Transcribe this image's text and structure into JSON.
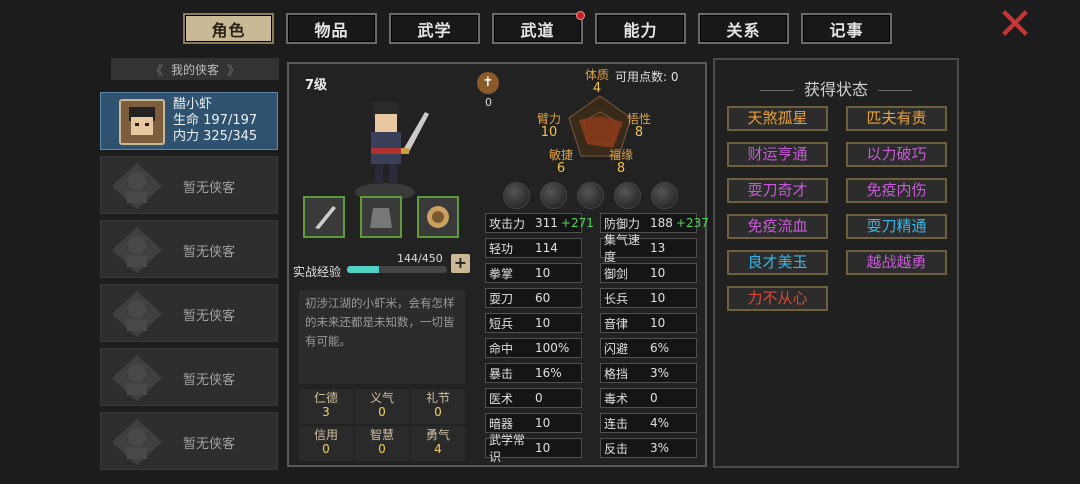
{
  "tabs": [
    {
      "label": "角色",
      "active": true
    },
    {
      "label": "物品"
    },
    {
      "label": "武学"
    },
    {
      "label": "武道",
      "badge": true
    },
    {
      "label": "能力"
    },
    {
      "label": "关系"
    },
    {
      "label": "记事"
    }
  ],
  "close": "✕",
  "sidebar": {
    "title": "我的侠客",
    "hero": {
      "name": "醋小虾",
      "hp": "生命 197/197",
      "mp": "内力 325/345"
    },
    "empty": "暂无侠客"
  },
  "profile": {
    "level": "7级",
    "exp_label": "实战经验",
    "exp": "144/450",
    "exp_ratio": 0.32,
    "desc": "初涉江湖的小虾米，会有怎样的未来还都是未知数，一切皆有可能。"
  },
  "virtues": [
    {
      "k": "仁德",
      "v": "3"
    },
    {
      "k": "义气",
      "v": "0"
    },
    {
      "k": "礼节",
      "v": "0"
    },
    {
      "k": "信用",
      "v": "0"
    },
    {
      "k": "智慧",
      "v": "0"
    },
    {
      "k": "勇气",
      "v": "4"
    }
  ],
  "points": "可用点数: 0",
  "fame": "0",
  "attrs": [
    {
      "k": "体质",
      "v": "4"
    },
    {
      "k": "臂力",
      "v": "10"
    },
    {
      "k": "悟性",
      "v": "8"
    },
    {
      "k": "敏捷",
      "v": "6"
    },
    {
      "k": "福缘",
      "v": "8"
    }
  ],
  "stats": [
    {
      "k": "攻击力",
      "v": "311",
      "b": "+271"
    },
    {
      "k": "防御力",
      "v": "188",
      "b": "+237"
    },
    {
      "k": "轻功",
      "v": "114"
    },
    {
      "k": "集气速度",
      "v": "13"
    },
    {
      "k": "拳掌",
      "v": "10"
    },
    {
      "k": "御剑",
      "v": "10"
    },
    {
      "k": "耍刀",
      "v": "60"
    },
    {
      "k": "长兵",
      "v": "10"
    },
    {
      "k": "短兵",
      "v": "10"
    },
    {
      "k": "音律",
      "v": "10"
    },
    {
      "k": "命中",
      "v": "100%"
    },
    {
      "k": "闪避",
      "v": "6%"
    },
    {
      "k": "暴击",
      "v": "16%"
    },
    {
      "k": "格挡",
      "v": "3%"
    },
    {
      "k": "医术",
      "v": "0"
    },
    {
      "k": "毒术",
      "v": "0"
    },
    {
      "k": "暗器",
      "v": "10"
    },
    {
      "k": "连击",
      "v": "4%"
    },
    {
      "k": "武学常识",
      "v": "10"
    },
    {
      "k": "反击",
      "v": "3%"
    }
  ],
  "status_title": "获得状态",
  "status": [
    {
      "t": "天煞孤星",
      "c": "#e8a23a"
    },
    {
      "t": "匹夫有责",
      "c": "#e8a23a"
    },
    {
      "t": "财运亨通",
      "c": "#c75ad6"
    },
    {
      "t": "以力破巧",
      "c": "#c75ad6"
    },
    {
      "t": "耍刀奇才",
      "c": "#c75ad6"
    },
    {
      "t": "免疫内伤",
      "c": "#c75ad6"
    },
    {
      "t": "免疫流血",
      "c": "#c75ad6"
    },
    {
      "t": "耍刀精通",
      "c": "#38b6e8"
    },
    {
      "t": "良才美玉",
      "c": "#38b6e8"
    },
    {
      "t": "越战越勇",
      "c": "#c75ad6"
    },
    {
      "t": "力不从心",
      "c": "#d84a3a"
    }
  ]
}
